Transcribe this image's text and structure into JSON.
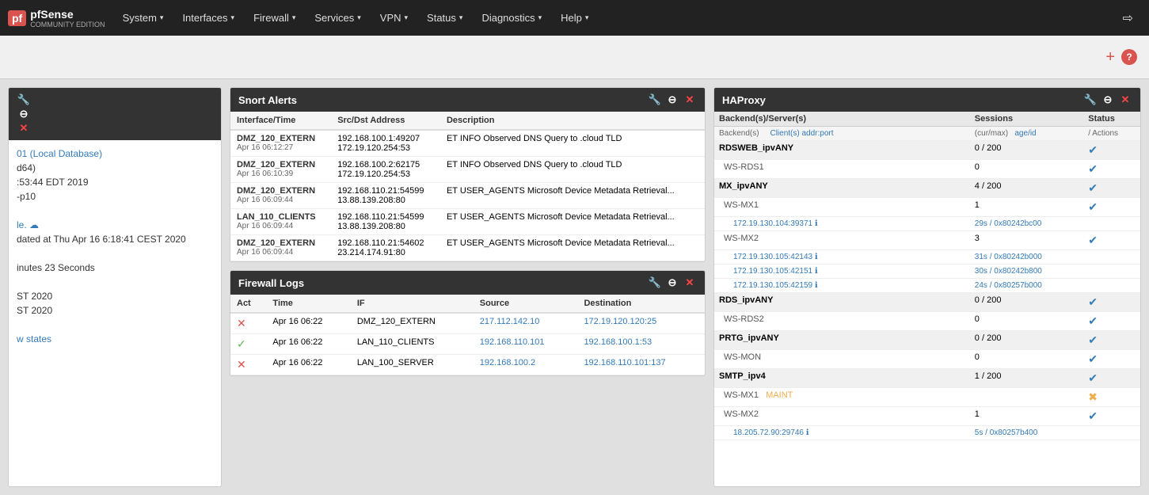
{
  "navbar": {
    "brand": "pfSense",
    "edition": "COMMUNITY EDITION",
    "items": [
      {
        "label": "System",
        "has_arrow": true
      },
      {
        "label": "Interfaces",
        "has_arrow": true
      },
      {
        "label": "Firewall",
        "has_arrow": true
      },
      {
        "label": "Services",
        "has_arrow": true
      },
      {
        "label": "VPN",
        "has_arrow": true
      },
      {
        "label": "Status",
        "has_arrow": true
      },
      {
        "label": "Diagnostics",
        "has_arrow": true
      },
      {
        "label": "Help",
        "has_arrow": true
      }
    ]
  },
  "toolbar": {
    "add_label": "+",
    "help_label": "?"
  },
  "left_panel": {
    "title_icon": "⚙",
    "items": [
      {
        "text": "01 (Local Database)",
        "class": "link"
      },
      {
        "text": "d64)",
        "class": "normal"
      },
      {
        "text": ":53:44 EDT 2019",
        "class": "normal"
      },
      {
        "text": "-p10",
        "class": "normal"
      },
      {
        "text": "",
        "class": "normal"
      },
      {
        "text": "le. ☁",
        "class": "link"
      },
      {
        "text": "dated at Thu Apr 16 6:18:41 CEST 2020",
        "class": "normal"
      },
      {
        "text": "",
        "class": "normal"
      },
      {
        "text": "inutes 23 Seconds",
        "class": "normal"
      },
      {
        "text": "",
        "class": "normal"
      },
      {
        "text": "ST 2020",
        "class": "normal"
      },
      {
        "text": "ST 2020",
        "class": "normal"
      },
      {
        "text": "",
        "class": "normal"
      },
      {
        "text": "w states",
        "class": "link"
      }
    ]
  },
  "snort_alerts": {
    "panel_title": "Snort Alerts",
    "columns": [
      "Interface/Time",
      "Src/Dst Address",
      "Description"
    ],
    "rows": [
      {
        "interface": "DMZ_120_EXTERN",
        "time": "Apr 16 06:12:27",
        "src": "192.168.100.1:49207",
        "dst": "172.19.120.254:53",
        "description": "ET INFO Observed DNS Query to .cloud TLD"
      },
      {
        "interface": "DMZ_120_EXTERN",
        "time": "Apr 16 06:10:39",
        "src": "192.168.100.2:62175",
        "dst": "172.19.120.254:53",
        "description": "ET INFO Observed DNS Query to .cloud TLD"
      },
      {
        "interface": "DMZ_120_EXTERN",
        "time": "Apr 16 06:09:44",
        "src": "192.168.110.21:54599",
        "dst": "13.88.139.208:80",
        "description": "ET USER_AGENTS Microsoft Device Metadata Retrieval..."
      },
      {
        "interface": "LAN_110_CLIENTS",
        "time": "Apr 16 06:09:44",
        "src": "192.168.110.21:54599",
        "dst": "13.88.139.208:80",
        "description": "ET USER_AGENTS Microsoft Device Metadata Retrieval..."
      },
      {
        "interface": "DMZ_120_EXTERN",
        "time": "Apr 16 06:09:44",
        "src": "192.168.110.21:54602",
        "dst": "23.214.174.91:80",
        "description": "ET USER_AGENTS Microsoft Device Metadata Retrieval..."
      }
    ]
  },
  "firewall_logs": {
    "panel_title": "Firewall Logs",
    "columns": [
      "Act",
      "Time",
      "IF",
      "Source",
      "Destination"
    ],
    "rows": [
      {
        "act": "x",
        "time": "Apr 16 06:22",
        "interface": "DMZ_120_EXTERN",
        "source": "217.112.142.10",
        "destination": "172.19.120.120:25"
      },
      {
        "act": "check",
        "time": "Apr 16 06:22",
        "interface": "LAN_110_CLIENTS",
        "source": "192.168.110.101",
        "destination": "192.168.100.1:53"
      },
      {
        "act": "x",
        "time": "Apr 16 06:22",
        "interface": "LAN_100_SERVER",
        "source": "192.168.100.2",
        "destination": "192.168.110.101:137"
      }
    ]
  },
  "haproxy": {
    "panel_title": "HAProxy",
    "col_backends": "Backend(s)/Server(s)",
    "col_backends_sub": "Backend(s)",
    "col_sessions": "Sessions",
    "col_sessions_sub": "(cur/max)",
    "col_status": "Status",
    "col_status_sub": "/",
    "col_clients": "Client(s) addr:port",
    "col_age": "age/id",
    "col_actions": "Actions",
    "backends": [
      {
        "name": "RDSWEB_ipvANY",
        "sessions": "0 / 200",
        "status": "check",
        "servers": [
          {
            "name": "WS-RDS1",
            "sessions": "0",
            "status": "check",
            "clients": []
          }
        ]
      },
      {
        "name": "MX_ipvANY",
        "sessions": "4 / 200",
        "status": "check",
        "servers": [
          {
            "name": "WS-MX1",
            "sessions": "1",
            "status": "check",
            "clients": [
              {
                "addr": "172.19.130.104:39371",
                "age_id": "29s / 0x80242bc00"
              }
            ]
          },
          {
            "name": "WS-MX2",
            "sessions": "3",
            "status": "check",
            "clients": [
              {
                "addr": "172.19.130.105:42143",
                "age_id": "31s / 0x80242b000"
              },
              {
                "addr": "172.19.130.105:42151",
                "age_id": "30s / 0x80242b800"
              },
              {
                "addr": "172.19.130.105:42159",
                "age_id": "24s / 0x80257b000"
              }
            ]
          }
        ]
      },
      {
        "name": "RDS_ipvANY",
        "sessions": "0 / 200",
        "status": "check",
        "servers": [
          {
            "name": "WS-RDS2",
            "sessions": "0",
            "status": "check",
            "clients": []
          }
        ]
      },
      {
        "name": "PRTG_ipvANY",
        "sessions": "0 / 200",
        "status": "check",
        "servers": [
          {
            "name": "WS-MON",
            "sessions": "0",
            "status": "check",
            "clients": []
          }
        ]
      },
      {
        "name": "SMTP_ipv4",
        "sessions": "1 / 200",
        "status": "check",
        "servers": [
          {
            "name": "WS-MX1",
            "sessions": "",
            "status": "maint",
            "clients": []
          },
          {
            "name": "WS-MX2",
            "sessions": "1",
            "status": "check",
            "clients": [
              {
                "addr": "18.205.72.90:29746",
                "age_id": "5s / 0x80257b400"
              }
            ]
          }
        ]
      }
    ]
  }
}
